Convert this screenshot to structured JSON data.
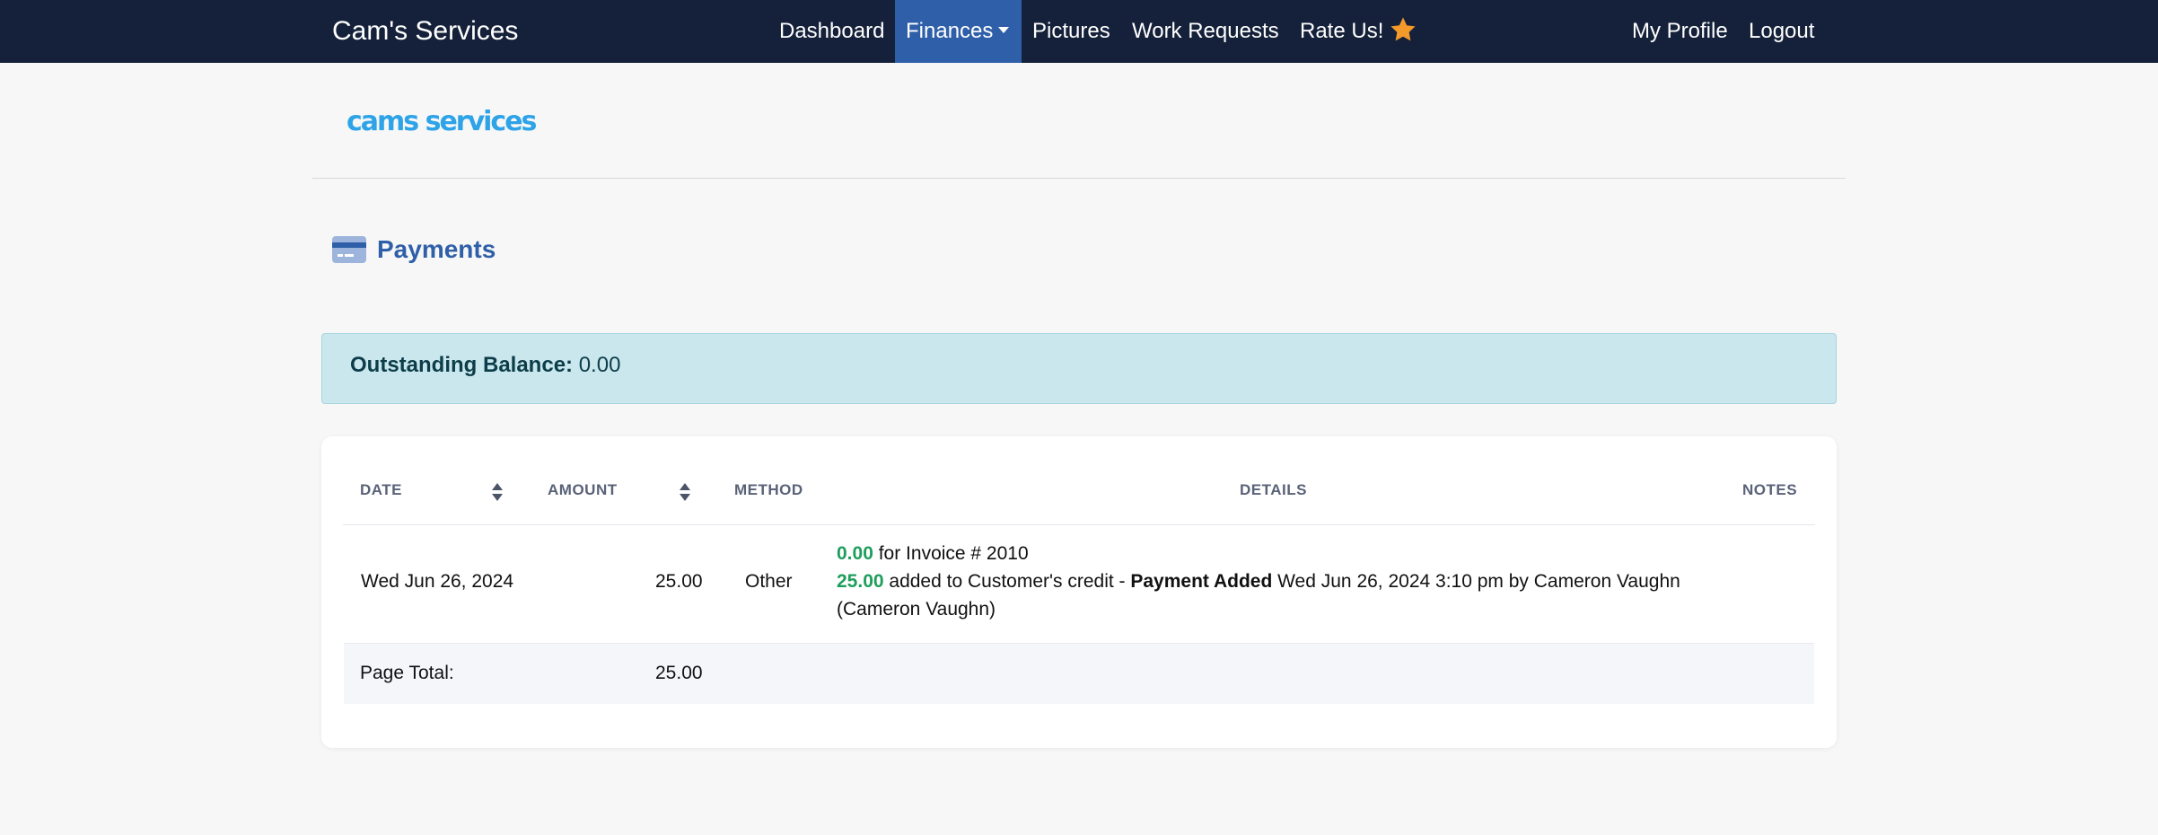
{
  "nav": {
    "brand": "Cam's Services",
    "items": [
      "Dashboard",
      "Finances",
      "Pictures",
      "Work Requests",
      "Rate Us!"
    ],
    "right": [
      "My Profile",
      "Logout"
    ]
  },
  "logo": {
    "text": "cams services"
  },
  "page": {
    "title": "Payments"
  },
  "alert": {
    "label": "Outstanding Balance:",
    "value": "0.00"
  },
  "table": {
    "headers": [
      "DATE",
      "AMOUNT",
      "METHOD",
      "DETAILS",
      "NOTES"
    ],
    "rows": [
      {
        "date": "Wed Jun 26, 2024",
        "amount": "25.00",
        "method": "Other",
        "details": {
          "line1_amount": "0.00",
          "line1_text": " for Invoice # 2010",
          "line2_amount": "25.00",
          "line2_text": " added to Customer's credit - ",
          "line2_status": "Payment Added",
          "line2_rest": " Wed Jun 26, 2024 3:10 pm by Cameron Vaughn",
          "line3_text": "(Cameron Vaughn)"
        },
        "notes": ""
      }
    ],
    "total": {
      "label": "Page Total:",
      "amount": "25.00"
    }
  },
  "colors": {
    "navbar": "#15213a",
    "active": "#2f5fa8",
    "title": "#2f5fa8",
    "alert_bg": "#cae7ee",
    "green": "#1e9e5c",
    "star": "#f39a2b"
  }
}
